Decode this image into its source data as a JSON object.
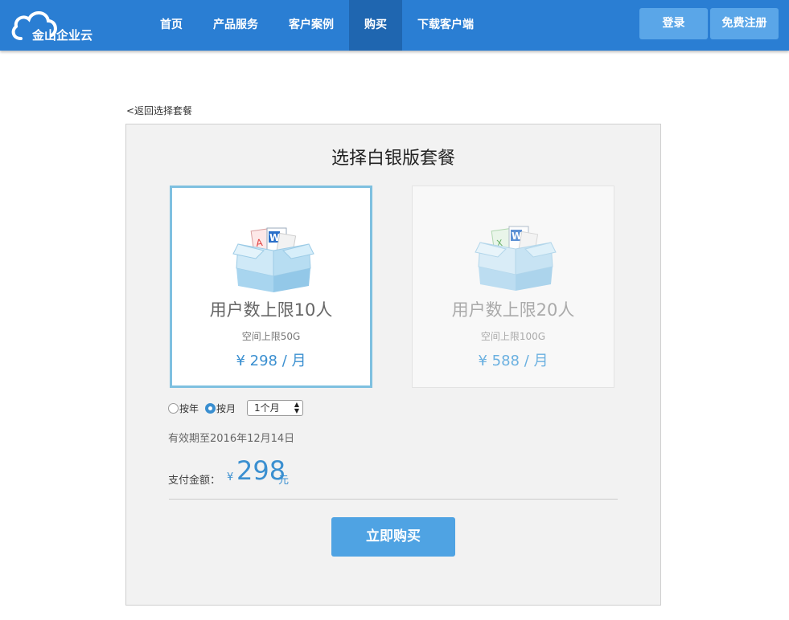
{
  "header": {
    "logo_text": "金山企业云",
    "nav": [
      {
        "label": "首页",
        "active": false
      },
      {
        "label": "产品服务",
        "active": false
      },
      {
        "label": "客户案例",
        "active": false
      },
      {
        "label": "购买",
        "active": true
      },
      {
        "label": "下载客户端",
        "active": false
      }
    ],
    "login_label": "登录",
    "register_label": "免费注册"
  },
  "back_link": "<返回选择套餐",
  "panel": {
    "title": "选择白银版套餐",
    "plans": [
      {
        "name": "用户数上限10人",
        "space": "空间上限50G",
        "price": "¥ 298 / 月",
        "selected": true
      },
      {
        "name": "用户数上限20人",
        "space": "空间上限100G",
        "price": "¥ 588 / 月",
        "selected": false
      }
    ],
    "billing": {
      "yearly_label": "按年",
      "monthly_label": "按月",
      "selected": "monthly",
      "duration_value": "1个月"
    },
    "validity_text": "有效期至2016年12月14日",
    "payment": {
      "label": "支付金额：",
      "currency": "¥",
      "amount": "298",
      "unit": "元"
    },
    "buy_label": "立即购买"
  },
  "colors": {
    "header_bg": "#2a7ed3",
    "nav_active_bg": "#1f66b0",
    "header_button_bg": "#5aa6e8",
    "accent": "#3a8fd0",
    "buy_button_bg": "#4fa3e3",
    "selected_border": "#7ec0e0",
    "panel_bg": "#f2f2f2"
  },
  "icons": [
    "cloud-logo-icon",
    "document-box-icon",
    "radio-icon",
    "select-arrows-icon"
  ]
}
